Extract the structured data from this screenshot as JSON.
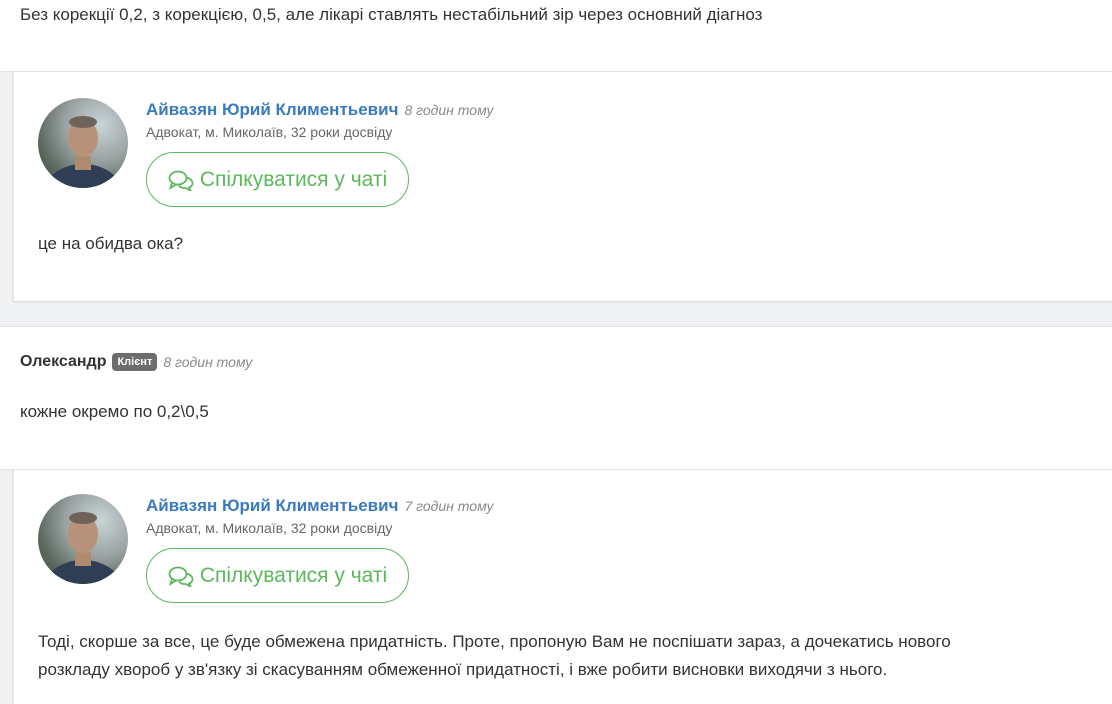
{
  "messages": [
    {
      "type": "client",
      "text": "Без корекції 0,2, з корекцією, 0,5, але лікарі ставлять нестабільний зір через основний діагноз"
    },
    {
      "type": "lawyer",
      "author": "Айвазян Юрий Климентьевич",
      "time": "8 годин тому",
      "subtitle": "Адвокат, м. Миколаїв, 32 роки досвіду",
      "chat_button": "Спілкуватися у чаті",
      "text": "це на обидва ока?"
    },
    {
      "type": "client",
      "author": "Олександр",
      "badge": "Клієнт",
      "time": "8 годин тому",
      "text": "кожне окремо по 0,2\\0,5"
    },
    {
      "type": "lawyer",
      "author": "Айвазян Юрий Климентьевич",
      "time": "7 годин тому",
      "subtitle": "Адвокат, м. Миколаїв, 32 роки досвіду",
      "chat_button": "Спілкуватися у чаті",
      "text_line1": "Тоді, скорше за все, це буде обмежена придатність. Проте, пропоную Вам не поспішати зараз, а дочекатись нового",
      "text_line2": "розкладу хвороб у зв'язку зі скасуванням обмеженної придатності, і вже робити висновки виходячи з нього."
    }
  ],
  "colors": {
    "author_link": "#3a7bbf",
    "chat_green": "#5cb85c",
    "badge_bg": "#6d6d6d"
  },
  "icons": {
    "chat": "chat-bubbles-icon"
  }
}
